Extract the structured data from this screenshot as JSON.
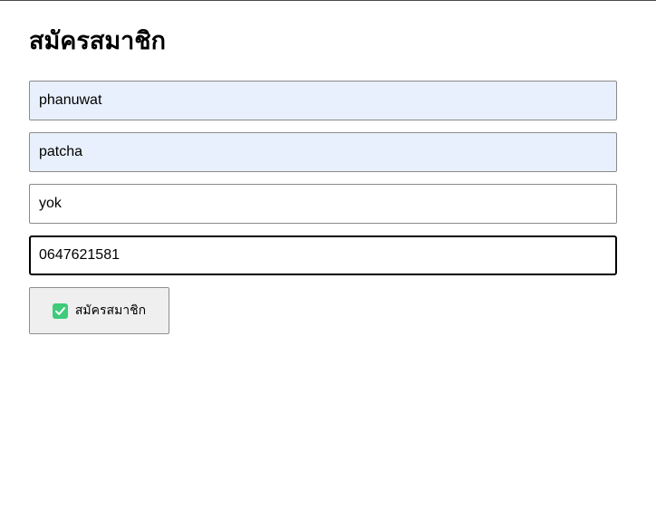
{
  "form": {
    "title": "สมัครสมาชิก",
    "fields": [
      {
        "value": "phanuwat"
      },
      {
        "value": "patcha"
      },
      {
        "value": "yok"
      },
      {
        "value": "0647621581"
      }
    ],
    "submit_label": "สมัครสมาชิก",
    "submit_icon": "check-icon",
    "colors": {
      "autofill_background": "#e8f0fe",
      "check_icon": "#3fcb7a",
      "button_background": "#efefef"
    }
  }
}
